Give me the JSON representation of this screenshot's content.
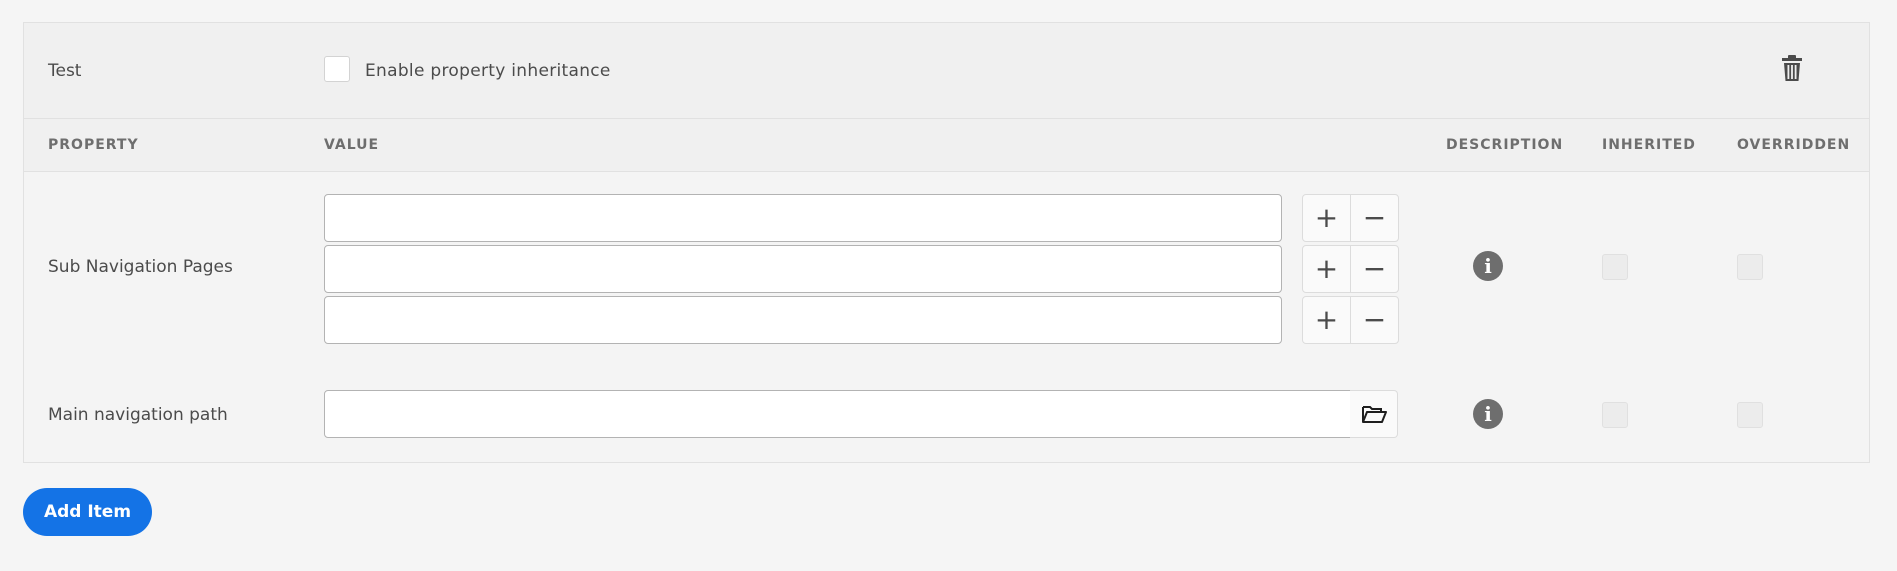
{
  "item": {
    "name": "Test",
    "inheritance_label": "Enable property inheritance",
    "inheritance_checked": false
  },
  "columns": {
    "property": "PROPERTY",
    "value": "VALUE",
    "description": "DESCRIPTION",
    "inherited": "INHERITED",
    "overridden": "OVERRIDDEN"
  },
  "rows": [
    {
      "label": "Sub Navigation Pages",
      "values": [
        "",
        "",
        ""
      ],
      "add_symbol": "+",
      "remove_symbol": "−",
      "description_icon": "info-icon",
      "inherited": false,
      "overridden": false
    },
    {
      "label": "Main navigation path",
      "value": "",
      "browse_icon": "folder-open-icon",
      "description_icon": "info-icon",
      "inherited": false,
      "overridden": false
    }
  ],
  "add_item_label": "Add Item",
  "colors": {
    "accent": "#1473e6",
    "text": "#4b4b4b",
    "icon": "#6e6e6e"
  }
}
